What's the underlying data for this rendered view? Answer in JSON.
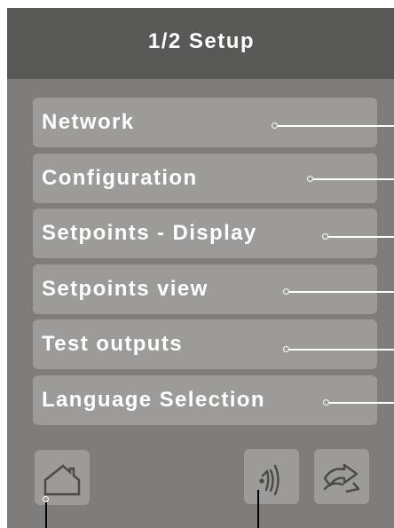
{
  "header": {
    "title": "1/2 Setup"
  },
  "menu": {
    "items": [
      {
        "label": "Network"
      },
      {
        "label": "Configuration"
      },
      {
        "label": "Setpoints - Display"
      },
      {
        "label": "Setpoints view"
      },
      {
        "label": "Test outputs"
      },
      {
        "label": "Language Selection"
      }
    ]
  },
  "footer": {
    "buttons": [
      {
        "icon": "home-icon"
      },
      {
        "icon": "sound-icon"
      },
      {
        "icon": "forward-arrow-icon"
      }
    ]
  },
  "colors": {
    "screen_bg": "#7e7d7b",
    "header_bg": "#585856",
    "button_bg": "#9c9b99",
    "text": "#ffffff"
  }
}
